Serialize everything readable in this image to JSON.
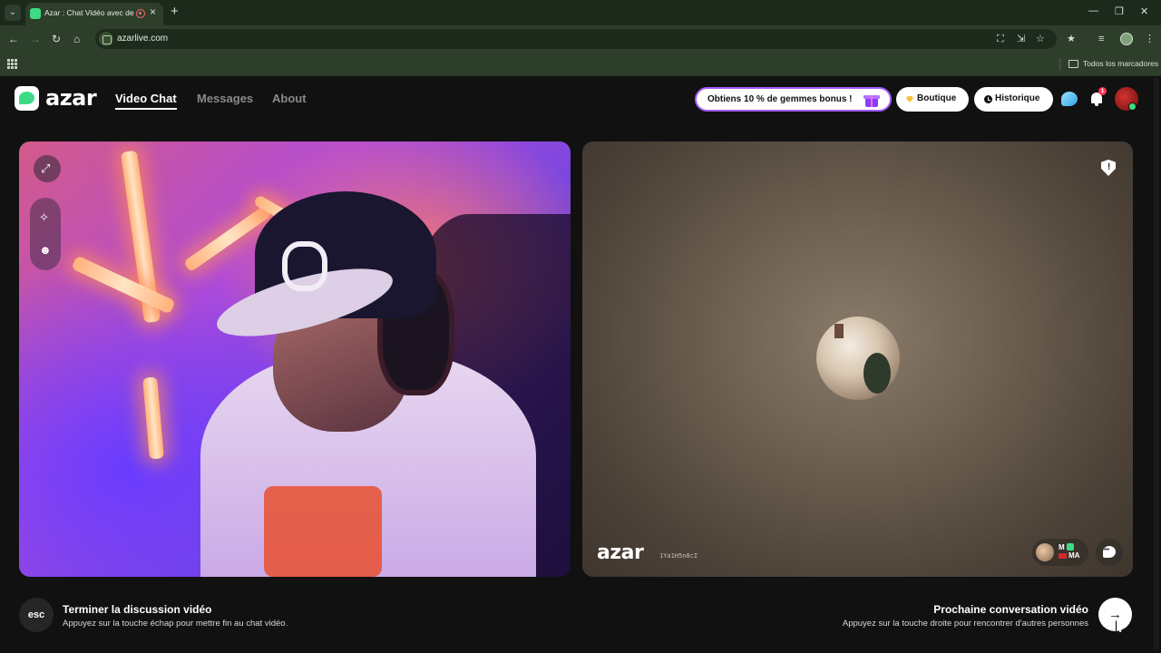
{
  "browser": {
    "tab_title": "Azar : Chat Vidéo avec de n",
    "url": "azarlive.com",
    "bookmarks_label": "Todos los marcadores"
  },
  "app": {
    "logo": "azar",
    "nav": [
      "Video Chat",
      "Messages",
      "About"
    ],
    "active_nav": "Video Chat",
    "promo": "Obtiens 10 % de gemmes bonus !",
    "shop_label": "Boutique",
    "history_label": "Historique",
    "notification_count": "1",
    "colors": {
      "brand": "#3ddc84",
      "promo_border": "#a05cff",
      "alert": "#ff3355"
    }
  },
  "peer": {
    "watermark": "azar",
    "watermark_id": "1Ya1H5n8cI",
    "gender": "M",
    "country": "MA"
  },
  "footer": {
    "esc_key": "esc",
    "end_title": "Terminer la discussion vidéo",
    "end_desc": "Appuyez sur la touche échap pour mettre fin au chat vidéo.",
    "next_title": "Prochaine conversation vidéo",
    "next_desc": "Appuyez sur la touche droite pour rencontrer d'autres personnes",
    "next_icon": "→"
  },
  "icons": [
    "expand-icon",
    "magic-wand-icon",
    "sticker-icon",
    "report-icon",
    "message-icon",
    "gift-icon",
    "gem-icon",
    "clock-icon",
    "bell-icon",
    "chat-bubble-icon"
  ]
}
